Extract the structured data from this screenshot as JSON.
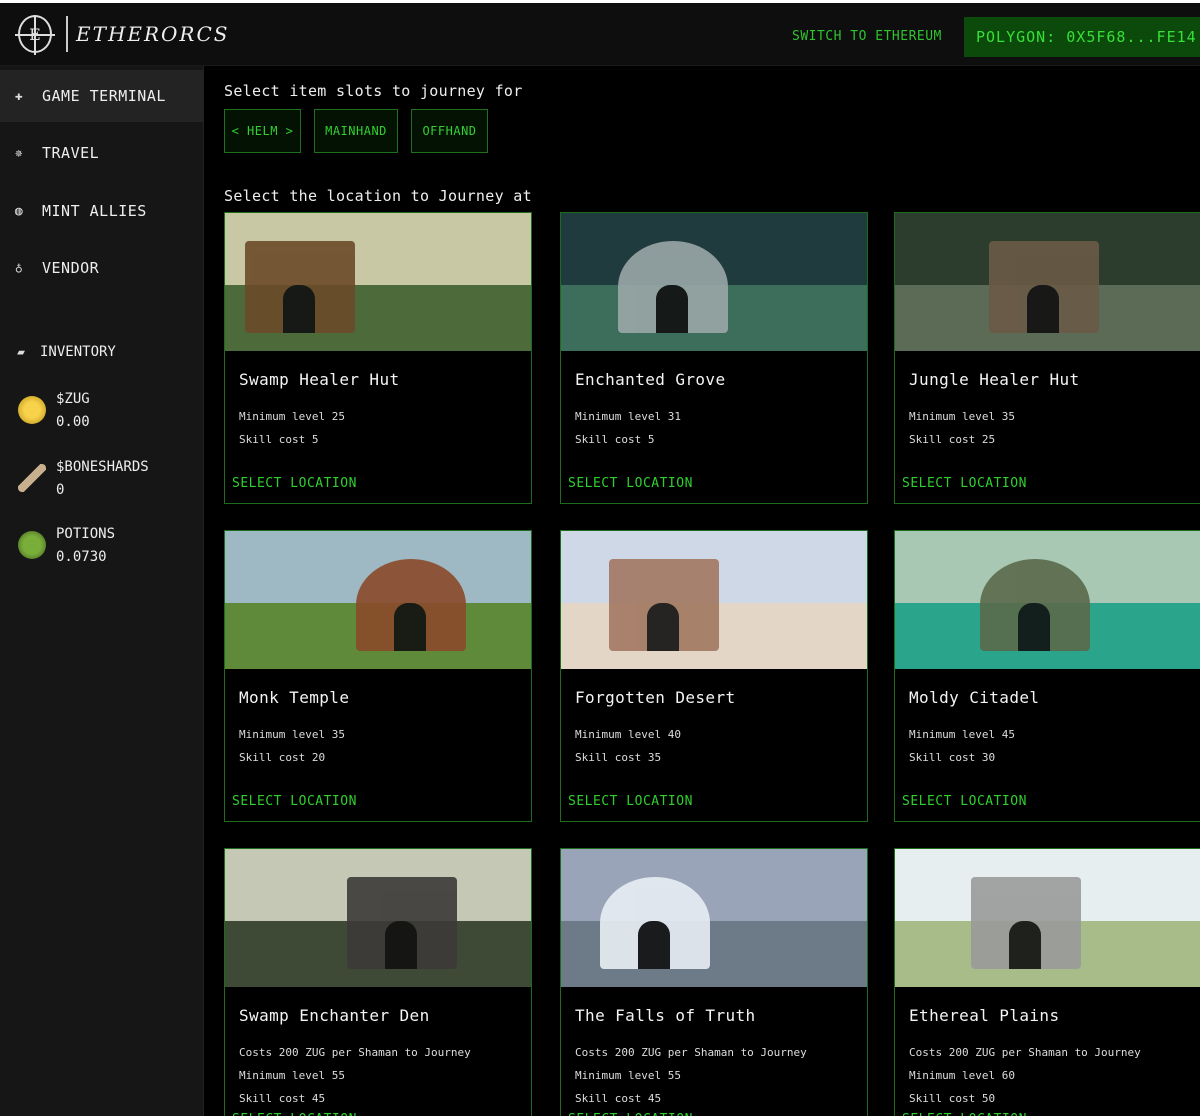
{
  "header": {
    "logo_text": "ETHERORCS",
    "switch_link": "SWITCH TO ETHEREUM",
    "wallet": "POLYGON: 0X5F68...FE14"
  },
  "sidebar": {
    "nav": [
      {
        "label": "GAME TERMINAL",
        "icon": "gamepad-icon"
      },
      {
        "label": "TRAVEL",
        "icon": "compass-icon"
      },
      {
        "label": "MINT ALLIES",
        "icon": "allies-icon"
      },
      {
        "label": "VENDOR",
        "icon": "potion-flask-icon"
      }
    ],
    "inventory_title": "INVENTORY",
    "inventory": [
      {
        "name": "$ZUG",
        "value": "0.00",
        "icon": "zug-coin-icon",
        "color": "#e2b21d"
      },
      {
        "name": "$BONESHARDS",
        "value": "0",
        "icon": "bone-icon",
        "color": "#b49a7a"
      },
      {
        "name": "POTIONS",
        "value": "0.0730",
        "icon": "potion-icon",
        "color": "#5a8a2a"
      }
    ]
  },
  "main": {
    "slots_label": "Select item slots to journey for",
    "slots": [
      "< HELM >",
      "MAINHAND",
      "OFFHAND"
    ],
    "location_label": "Select the location to Journey at",
    "select_label": "SELECT LOCATION",
    "locations": [
      {
        "name": "Swamp Healer Hut",
        "lines": [
          "Minimum level 25",
          "Skill cost 5"
        ],
        "sky": "#c9c8a4",
        "ground": "#4d6a3a",
        "accent": "#6b4a2a"
      },
      {
        "name": "Enchanted Grove",
        "lines": [
          "Minimum level 31",
          "Skill cost 5"
        ],
        "sky": "#1f3b3e",
        "ground": "#3d6d5b",
        "accent": "#9aa7a8"
      },
      {
        "name": "Jungle Healer Hut",
        "lines": [
          "Minimum level 35",
          "Skill cost 25"
        ],
        "sky": "#2c3d2e",
        "ground": "#5b6b55",
        "accent": "#6a5a46"
      },
      {
        "name": "Monk Temple",
        "lines": [
          "Minimum level 35",
          "Skill cost 20"
        ],
        "sky": "#9fb9c4",
        "ground": "#5f8a3a",
        "accent": "#8a4a2a"
      },
      {
        "name": "Forgotten Desert",
        "lines": [
          "Minimum level 40",
          "Skill cost 35"
        ],
        "sky": "#cfd8e6",
        "ground": "#e4d6c6",
        "accent": "#a27862"
      },
      {
        "name": "Moldy Citadel",
        "lines": [
          "Minimum level 45",
          "Skill cost 30"
        ],
        "sky": "#a8c8b4",
        "ground": "#2aa48a",
        "accent": "#5a6a4a"
      },
      {
        "name": "Swamp Enchanter Den",
        "lines": [
          "Costs 200 ZUG per Shaman to Journey",
          "Minimum level 55",
          "Skill cost 45"
        ],
        "sky": "#c4c8b4",
        "ground": "#3e4a36",
        "accent": "#3c3a38"
      },
      {
        "name": "The Falls of Truth",
        "lines": [
          "Costs 200 ZUG per Shaman to Journey",
          "Minimum level 55",
          "Skill cost 45"
        ],
        "sky": "#9aa4b8",
        "ground": "#6d7a88",
        "accent": "#e8eef4"
      },
      {
        "name": "Ethereal Plains",
        "lines": [
          "Costs 200 ZUG per Shaman to Journey",
          "Minimum level 60",
          "Skill cost 50"
        ],
        "sky": "#e6eef0",
        "ground": "#a8bc8a",
        "accent": "#9a9a9a"
      }
    ]
  }
}
